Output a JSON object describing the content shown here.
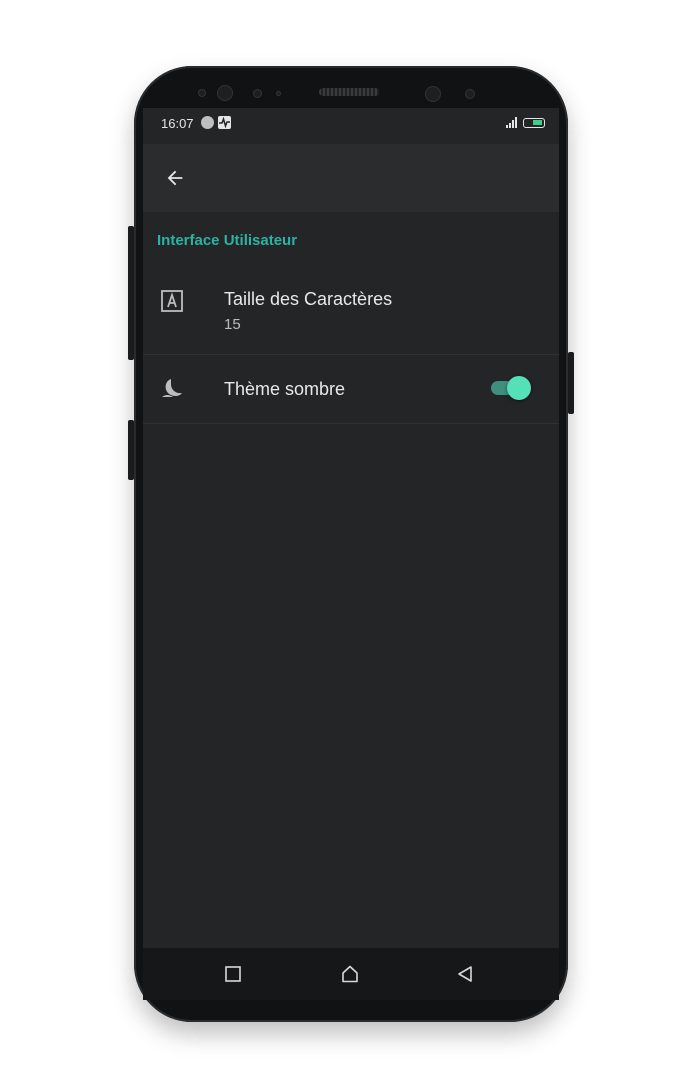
{
  "status_bar": {
    "time": "16:07",
    "icons": [
      "notification-circle-icon",
      "activity-pulse-icon",
      "signal-icon",
      "battery-charging-icon"
    ]
  },
  "toolbar": {
    "back_icon": "arrow-left-icon"
  },
  "preferences": {
    "section_title": "Interface Utilisateur",
    "items": [
      {
        "icon": "font-size-icon",
        "title": "Taille des Caractères",
        "summary": "15"
      },
      {
        "icon": "moon-icon",
        "title": "Thème sombre",
        "toggle_on": true
      }
    ]
  },
  "navigation": {
    "buttons": [
      "recent-apps-icon",
      "home-icon",
      "back-triangle-icon"
    ]
  },
  "colors": {
    "accent": "#2bb3a3",
    "toggle_thumb": "#55e0b7",
    "toggle_track": "#3f8f7d",
    "background": "#232526",
    "app_bar": "#2a2c2d"
  }
}
